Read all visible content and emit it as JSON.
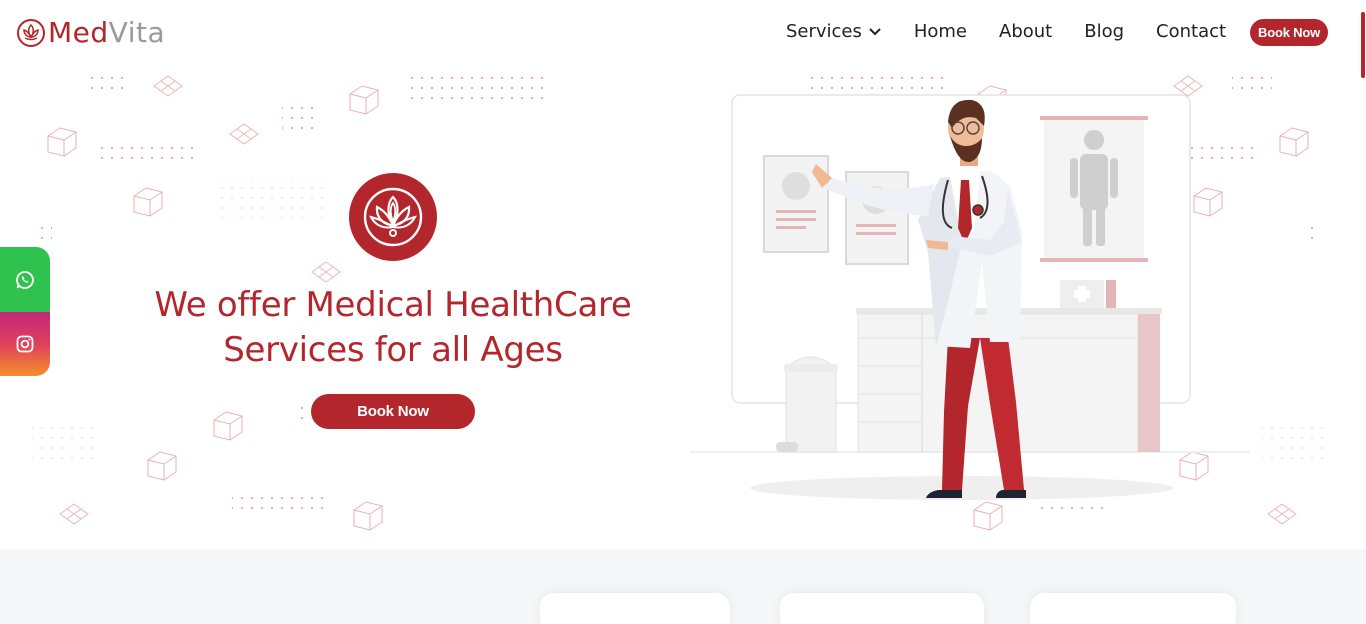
{
  "brand": {
    "name_part1": "Med",
    "name_part2": "Vita",
    "primary_color": "#b3262c",
    "secondary_color": "#9a9a9a"
  },
  "nav": {
    "items": [
      {
        "label": "Services",
        "has_dropdown": true
      },
      {
        "label": "Home"
      },
      {
        "label": "About"
      },
      {
        "label": "Blog"
      },
      {
        "label": "Contact"
      }
    ],
    "cta_label": "Book Now"
  },
  "hero": {
    "title_line1": "We offer Medical HealthCare",
    "title_line2": "Services for all Ages",
    "cta_label": "Book Now",
    "emblem_icon": "lotus-icon"
  },
  "social": [
    {
      "name": "whatsapp",
      "icon": "whatsapp-icon",
      "color": "#2fc24f"
    },
    {
      "name": "instagram",
      "icon": "instagram-icon",
      "color": "#c2277d"
    }
  ],
  "illustration": {
    "subject": "doctor-illustration"
  }
}
